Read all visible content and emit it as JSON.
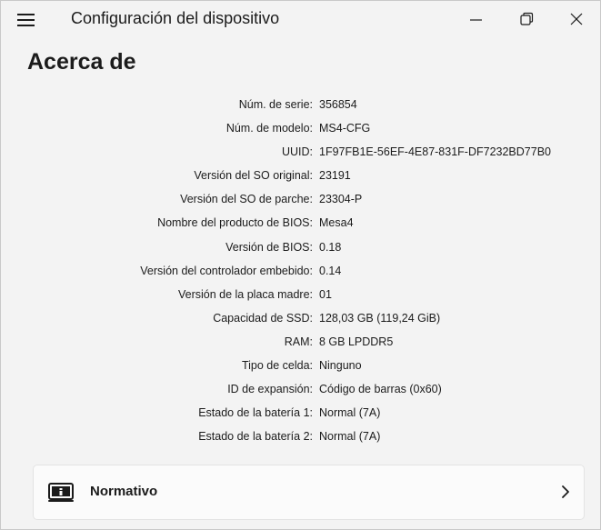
{
  "window": {
    "title": "Configuración del dispositivo",
    "buttons": [
      "minimize-icon",
      "maximize-icon",
      "close-icon"
    ]
  },
  "page": {
    "title": "Acerca de"
  },
  "info": [
    {
      "label": "Núm. de serie:",
      "value": "356854"
    },
    {
      "label": "Núm. de modelo:",
      "value": "MS4-CFG"
    },
    {
      "label": "UUID:",
      "value": "1F97FB1E-56EF-4E87-831F-DF7232BD77B0"
    },
    {
      "label": "Versión del SO original:",
      "value": "23191"
    },
    {
      "label": "Versión del SO de parche:",
      "value": "23304-P"
    },
    {
      "label": "Nombre del producto de BIOS:",
      "value": "Mesa4"
    },
    {
      "label": "Versión de BIOS:",
      "value": "0.18"
    },
    {
      "label": "Versión del controlador embebido:",
      "value": "0.14"
    },
    {
      "label": "Versión de la placa madre:",
      "value": "01"
    },
    {
      "label": "Capacidad de SSD:",
      "value": "128,03 GB (119,24 GiB)"
    },
    {
      "label": "RAM:",
      "value": "8 GB LPDDR5"
    },
    {
      "label": "Tipo de celda:",
      "value": "Ninguno"
    },
    {
      "label": "ID de expansión:",
      "value": "Código de barras (0x60)"
    },
    {
      "label": "Estado de la batería 1:",
      "value": "Normal (7A)"
    },
    {
      "label": "Estado de la batería 2:",
      "value": "Normal (7A)"
    }
  ],
  "regulatory_card": {
    "label": "Normativo",
    "icon": "regulatory-info-icon"
  }
}
